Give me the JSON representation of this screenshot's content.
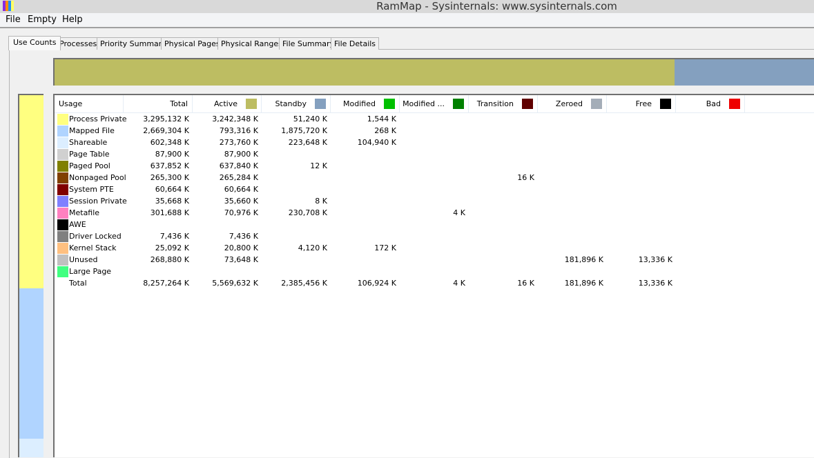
{
  "window": {
    "title": "RamMap - Sysinternals: www.sysinternals.com",
    "icon_colors": [
      "#8a2be2",
      "#ff8c00",
      "#1e90ff",
      "#ffff66"
    ]
  },
  "menu": [
    "File",
    "Empty",
    "Help"
  ],
  "tabs": [
    {
      "label": "Use Counts",
      "active": true
    },
    {
      "label": "Processes",
      "active": false
    },
    {
      "label": "Priority Summary",
      "active": false
    },
    {
      "label": "Physical Pages",
      "active": false
    },
    {
      "label": "Physical Ranges",
      "active": false
    },
    {
      "label": "File Summary",
      "active": false
    },
    {
      "label": "File Details",
      "active": false
    }
  ],
  "top_bar": {
    "segments": [
      {
        "name": "Active",
        "fraction": 0.8165,
        "color": "#bdbd62"
      },
      {
        "name": "Standby",
        "fraction": 0.1835,
        "color": "#84a0bf"
      }
    ]
  },
  "side_bar": {
    "segments": [
      {
        "name": "Process Private",
        "fraction": 0.5327,
        "color": "#ffff80"
      },
      {
        "name": "Mapped File",
        "fraction": 0.4151,
        "color": "#b0d4ff"
      },
      {
        "name": "Shareable",
        "fraction": 0.0522,
        "color": "#dceeff"
      }
    ]
  },
  "columns": [
    {
      "label": "Usage",
      "color": null
    },
    {
      "label": "Total",
      "color": null
    },
    {
      "label": "Active",
      "color": "#bdbd62"
    },
    {
      "label": "Standby",
      "color": "#84a0bf"
    },
    {
      "label": "Modified",
      "color": "#00c000"
    },
    {
      "label": "Modified ...",
      "color": "#008000"
    },
    {
      "label": "Transition",
      "color": "#600000"
    },
    {
      "label": "Zeroed",
      "color": "#a4adb8"
    },
    {
      "label": "Free",
      "color": "#000000"
    },
    {
      "label": "Bad",
      "color": "#ee0000"
    }
  ],
  "rows": [
    {
      "usage": "Process Private",
      "color": "#ffff80",
      "total": "3,295,132 K",
      "active": "3,242,348 K",
      "standby": "51,240 K",
      "modified": "1,544 K",
      "modified_no_write": "",
      "transition": "",
      "zeroed": "",
      "free": "",
      "bad": ""
    },
    {
      "usage": "Mapped File",
      "color": "#b0d4ff",
      "total": "2,669,304 K",
      "active": "793,316 K",
      "standby": "1,875,720 K",
      "modified": "268 K",
      "modified_no_write": "",
      "transition": "",
      "zeroed": "",
      "free": "",
      "bad": ""
    },
    {
      "usage": "Shareable",
      "color": "#dceeff",
      "total": "602,348 K",
      "active": "273,760 K",
      "standby": "223,648 K",
      "modified": "104,940 K",
      "modified_no_write": "",
      "transition": "",
      "zeroed": "",
      "free": "",
      "bad": ""
    },
    {
      "usage": "Page Table",
      "color": "#d0d0d0",
      "total": "87,900 K",
      "active": "87,900 K",
      "standby": "",
      "modified": "",
      "modified_no_write": "",
      "transition": "",
      "zeroed": "",
      "free": "",
      "bad": ""
    },
    {
      "usage": "Paged Pool",
      "color": "#808000",
      "total": "637,852 K",
      "active": "637,840 K",
      "standby": "12 K",
      "modified": "",
      "modified_no_write": "",
      "transition": "",
      "zeroed": "",
      "free": "",
      "bad": ""
    },
    {
      "usage": "Nonpaged Pool",
      "color": "#804000",
      "total": "265,300 K",
      "active": "265,284 K",
      "standby": "",
      "modified": "",
      "modified_no_write": "",
      "transition": "16 K",
      "zeroed": "",
      "free": "",
      "bad": ""
    },
    {
      "usage": "System PTE",
      "color": "#800000",
      "total": "60,664 K",
      "active": "60,664 K",
      "standby": "",
      "modified": "",
      "modified_no_write": "",
      "transition": "",
      "zeroed": "",
      "free": "",
      "bad": ""
    },
    {
      "usage": "Session Private",
      "color": "#8080ff",
      "total": "35,668 K",
      "active": "35,660 K",
      "standby": "8 K",
      "modified": "",
      "modified_no_write": "",
      "transition": "",
      "zeroed": "",
      "free": "",
      "bad": ""
    },
    {
      "usage": "Metafile",
      "color": "#ff80c0",
      "total": "301,688 K",
      "active": "70,976 K",
      "standby": "230,708 K",
      "modified": "",
      "modified_no_write": "4 K",
      "transition": "",
      "zeroed": "",
      "free": "",
      "bad": ""
    },
    {
      "usage": "AWE",
      "color": "#000000",
      "total": "",
      "active": "",
      "standby": "",
      "modified": "",
      "modified_no_write": "",
      "transition": "",
      "zeroed": "",
      "free": "",
      "bad": ""
    },
    {
      "usage": "Driver Locked",
      "color": "#808080",
      "total": "7,436 K",
      "active": "7,436 K",
      "standby": "",
      "modified": "",
      "modified_no_write": "",
      "transition": "",
      "zeroed": "",
      "free": "",
      "bad": ""
    },
    {
      "usage": "Kernel Stack",
      "color": "#ffc080",
      "total": "25,092 K",
      "active": "20,800 K",
      "standby": "4,120 K",
      "modified": "172 K",
      "modified_no_write": "",
      "transition": "",
      "zeroed": "",
      "free": "",
      "bad": ""
    },
    {
      "usage": "Unused",
      "color": "#c0c0c0",
      "total": "268,880 K",
      "active": "73,648 K",
      "standby": "",
      "modified": "",
      "modified_no_write": "",
      "transition": "",
      "zeroed": "181,896 K",
      "free": "13,336 K",
      "bad": ""
    },
    {
      "usage": "Large Page",
      "color": "#40ff80",
      "total": "",
      "active": "",
      "standby": "",
      "modified": "",
      "modified_no_write": "",
      "transition": "",
      "zeroed": "",
      "free": "",
      "bad": ""
    },
    {
      "usage": "Total",
      "color": null,
      "total": "8,257,264 K",
      "active": "5,569,632 K",
      "standby": "2,385,456 K",
      "modified": "106,924 K",
      "modified_no_write": "4 K",
      "transition": "16 K",
      "zeroed": "181,896 K",
      "free": "13,336 K",
      "bad": ""
    }
  ]
}
